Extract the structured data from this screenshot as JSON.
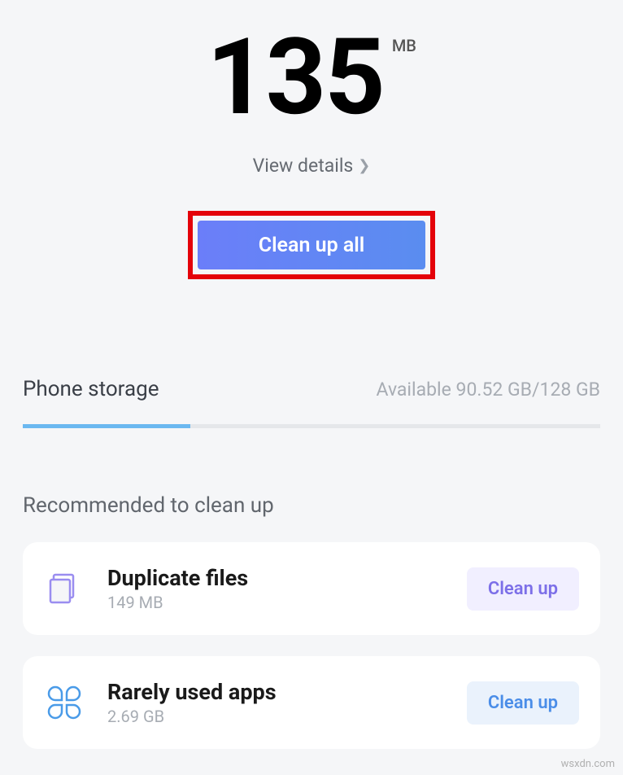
{
  "hero": {
    "value": "135",
    "unit": "MB",
    "view_details": "View details",
    "cleanup_all": "Clean up all"
  },
  "storage": {
    "title": "Phone storage",
    "available_prefix": "Available ",
    "available_value": "90.52 GB",
    "separator": "/",
    "total_value": "128 GB",
    "fill_percent": 29
  },
  "recommend": {
    "title": "Recommended to clean up",
    "items": [
      {
        "icon": "duplicate-icon",
        "title": "Duplicate files",
        "subtitle": "149 MB",
        "button": "Clean up",
        "accent": "purple"
      },
      {
        "icon": "apps-icon",
        "title": "Rarely used apps",
        "subtitle": "2.69 GB",
        "button": "Clean up",
        "accent": "blue"
      }
    ]
  },
  "watermark": "wsxdn.com"
}
